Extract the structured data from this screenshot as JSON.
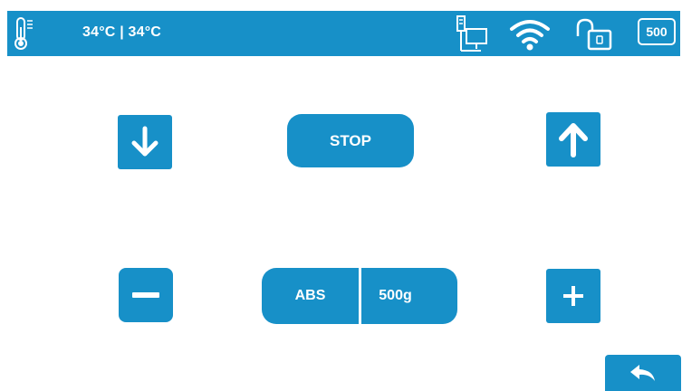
{
  "status_bar": {
    "temperature_readout": "34°C | 34°C",
    "counter_badge": "500",
    "icons": [
      "thermometer-icon",
      "network-icon",
      "wifi-icon",
      "unlock-icon"
    ]
  },
  "controls": {
    "stop_label": "STOP",
    "material_label": "ABS",
    "weight_label": "500g",
    "icons": [
      "arrow-down-icon",
      "arrow-up-icon",
      "minus-icon",
      "plus-icon",
      "back-arrow-icon"
    ]
  },
  "colors": {
    "accent": "#1790c8",
    "foreground": "#ffffff",
    "background": "#ffffff"
  }
}
